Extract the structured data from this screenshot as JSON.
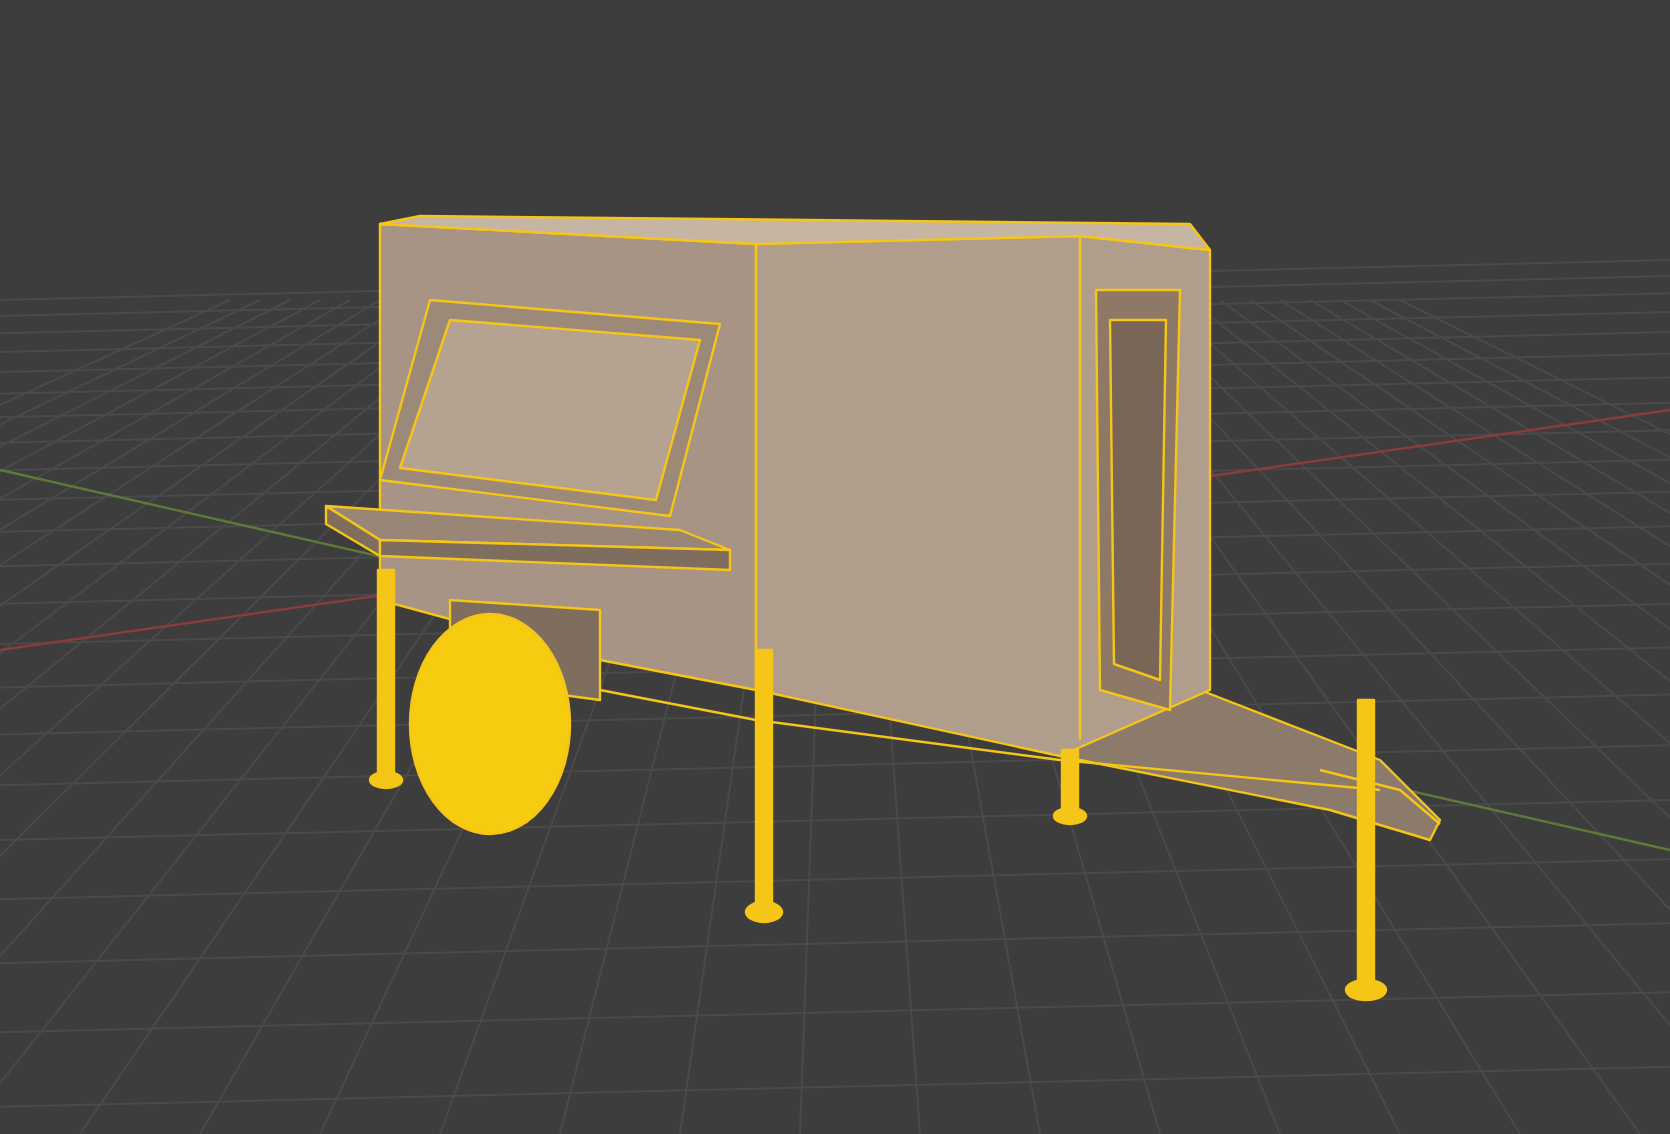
{
  "viewport": {
    "show_grid": true,
    "show_axes": true
  }
}
